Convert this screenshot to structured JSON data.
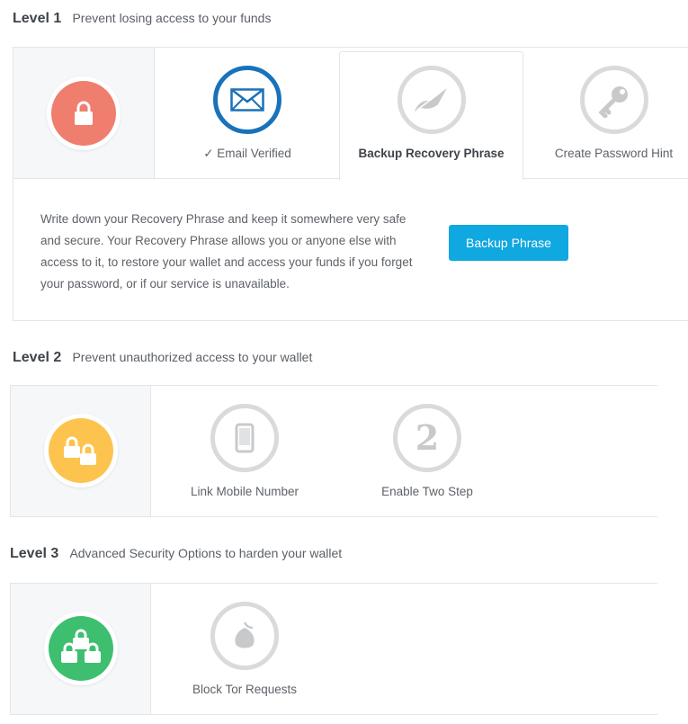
{
  "colors": {
    "level1": "#ef7e6f",
    "level2": "#fcc44f",
    "level3": "#3dbf6f",
    "accent": "#10a8e0",
    "verified": "#1a72b9",
    "inactive": "#d9dadc"
  },
  "level1": {
    "label": "Level 1",
    "description": "Prevent losing access to your funds",
    "badge_icon": "lock-icon",
    "steps": [
      {
        "label": "✓ Email Verified",
        "icon": "envelope-icon",
        "state": "done"
      },
      {
        "label": "Backup Recovery Phrase",
        "icon": "quill-icon",
        "state": "active"
      },
      {
        "label": "Create Password Hint",
        "icon": "key-icon",
        "state": "pending"
      }
    ],
    "detail": {
      "text": "Write down your Recovery Phrase and keep it somewhere very safe and secure. Your Recovery Phrase allows you or anyone else with access to it, to restore your wallet and access your funds if you forget your password, or if our service is unavailable.",
      "button_label": "Backup Phrase"
    }
  },
  "level2": {
    "label": "Level 2",
    "description": "Prevent unauthorized access to your wallet",
    "badge_icon": "double-lock-icon",
    "steps": [
      {
        "label": "Link Mobile Number",
        "icon": "mobile-phone-icon"
      },
      {
        "label": "Enable Two Step",
        "icon": "two-step-icon"
      }
    ]
  },
  "level3": {
    "label": "Level 3",
    "description": "Advanced Security Options to harden your wallet",
    "badge_icon": "triple-lock-icon",
    "steps": [
      {
        "label": "Block Tor Requests",
        "icon": "tor-onion-icon"
      }
    ]
  }
}
